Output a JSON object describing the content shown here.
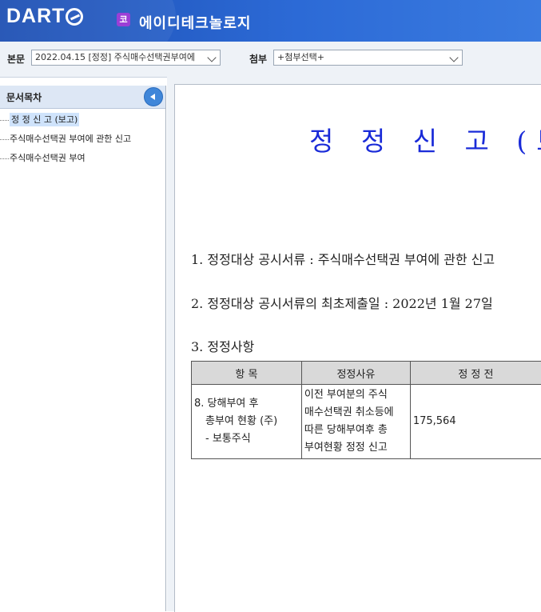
{
  "header": {
    "logo_text": "DART",
    "company_badge": "코",
    "company_name": "에이디테크놀로지"
  },
  "toolbar": {
    "body_label": "본문",
    "body_select_value": "2022.04.15 [정정] 주식매수선택권부여에",
    "attach_label": "첨부",
    "attach_select_value": "+첨부선택+"
  },
  "sidebar": {
    "title": "문서목차",
    "items": [
      {
        "label": "정 정 신 고 (보고)"
      },
      {
        "label": "주식매수선택권 부여에 관한 신고"
      },
      {
        "label": "주식매수선택권 부여"
      }
    ]
  },
  "document": {
    "title": "정 정 신 고 (보고)",
    "line1": "1. 정정대상 공시서류 : 주식매수선택권 부여에 관한 신고",
    "line2": "2. 정정대상 공시서류의 최초제출일 : 2022년 1월 27일",
    "line3": "3. 정정사항",
    "table": {
      "headers": [
        "항 목",
        "정정사유",
        "정 정 전"
      ],
      "row": {
        "item_l1": "8. 당해부여 후",
        "item_l2": "총부여  현황 (주)",
        "item_l3": "- 보통주식",
        "reason_l1": "이전 부여분의 주식",
        "reason_l2": "매수선택권 취소등에",
        "reason_l3": "따른 당해부여후 총",
        "reason_l4": "부여현황 정정 신고",
        "before": "175,564"
      }
    }
  }
}
